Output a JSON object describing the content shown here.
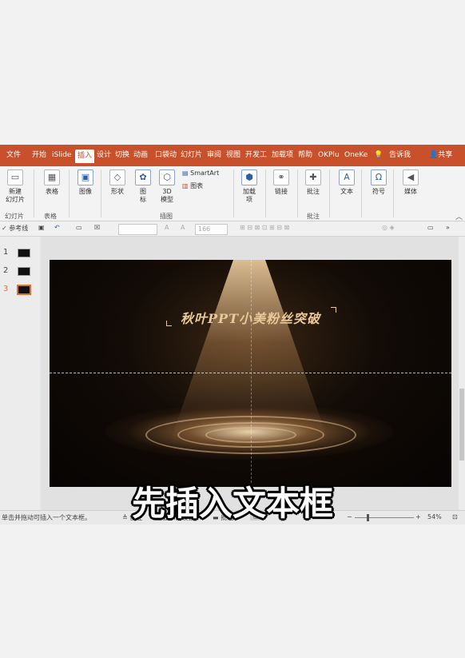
{
  "menubar": {
    "tabs": [
      "文件",
      "开始",
      "iSlide",
      "插入",
      "设计",
      "切换",
      "动画",
      "口袋动",
      "幻灯片",
      "审阅",
      "视图",
      "开发工",
      "加载项",
      "帮助",
      "OKPlu",
      "OneKe"
    ],
    "active_tab": "插入",
    "tell_me": "告诉我",
    "share": "共享",
    "accent": "#c8502a"
  },
  "ribbon": {
    "new_slide": "新建\n幻灯片",
    "table": "表格",
    "image": "图像",
    "shapes": "形状",
    "icons": "图\n标",
    "model3d": "3D\n模型",
    "smartart": "SmartArt",
    "chart": "图表",
    "addins": "加载\n项",
    "link": "链接",
    "comment": "批注",
    "text": "文本",
    "symbols": "符号",
    "media": "媒体",
    "groups": {
      "slides": "幻灯片",
      "tables": "表格",
      "illustrations": "插图",
      "comments": "批注"
    }
  },
  "toolbar2": {
    "guides": "参考线",
    "font_size": "166"
  },
  "slides": {
    "numbers": [
      "1",
      "2",
      "3"
    ],
    "active": "3"
  },
  "slide": {
    "title": "秋叶PPT小美粉丝突破"
  },
  "status": {
    "hint": "单击并拖动可插入一个文本框。",
    "notes": "备注",
    "display_settings": "显示器设置",
    "comments": "批注",
    "zoom": "54%"
  },
  "subtitle": "先插入文本框"
}
